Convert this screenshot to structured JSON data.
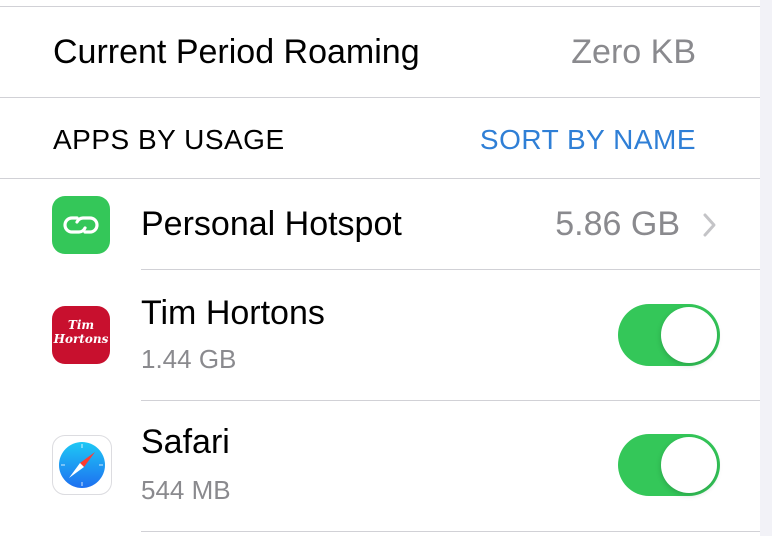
{
  "roaming": {
    "label": "Current Period Roaming",
    "value": "Zero KB"
  },
  "section": {
    "header": "APPS BY USAGE",
    "sort_label": "SORT BY NAME"
  },
  "apps": [
    {
      "name": "Personal Hotspot",
      "usage": "5.86 GB",
      "icon": "hotspot-icon",
      "has_chevron": true
    },
    {
      "name": "Tim Hortons",
      "usage": "1.44 GB",
      "icon": "tim-hortons-icon",
      "icon_text_1": "Tim",
      "icon_text_2": "Hortons",
      "toggle_on": true
    },
    {
      "name": "Safari",
      "usage": "544 MB",
      "icon": "safari-icon",
      "toggle_on": true
    }
  ],
  "colors": {
    "accent_blue": "#2f7fd6",
    "toggle_green": "#34c759",
    "hotspot_green": "#34c759",
    "tim_hortons_red": "#c8102e"
  }
}
